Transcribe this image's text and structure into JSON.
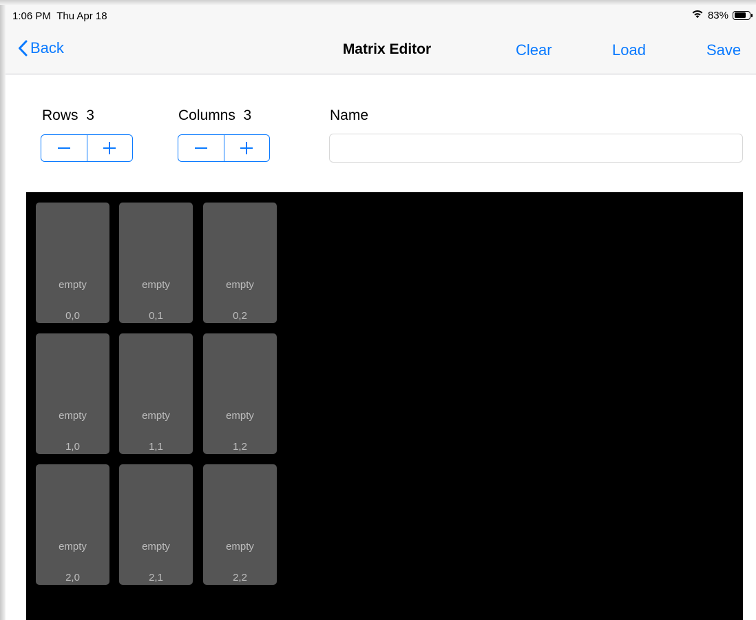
{
  "status_bar": {
    "time": "1:06 PM",
    "date": "Thu Apr 18",
    "battery_percent": "83%",
    "battery_level": 0.83,
    "wifi_icon": "wifi-icon"
  },
  "nav": {
    "back_label": "Back",
    "title": "Matrix Editor",
    "clear_label": "Clear",
    "load_label": "Load",
    "save_label": "Save",
    "accent_color": "#0a7aff"
  },
  "controls": {
    "rows_label": "Rows",
    "rows_value": "3",
    "columns_label": "Columns",
    "columns_value": "3",
    "name_label": "Name",
    "name_value": "",
    "name_placeholder": ""
  },
  "matrix": {
    "background": "#000000",
    "cell_color": "#555555",
    "cells": [
      [
        {
          "value": "empty",
          "coord": "0,0"
        },
        {
          "value": "empty",
          "coord": "0,1"
        },
        {
          "value": "empty",
          "coord": "0,2"
        }
      ],
      [
        {
          "value": "empty",
          "coord": "1,0"
        },
        {
          "value": "empty",
          "coord": "1,1"
        },
        {
          "value": "empty",
          "coord": "1,2"
        }
      ],
      [
        {
          "value": "empty",
          "coord": "2,0"
        },
        {
          "value": "empty",
          "coord": "2,1"
        },
        {
          "value": "empty",
          "coord": "2,2"
        }
      ]
    ]
  }
}
